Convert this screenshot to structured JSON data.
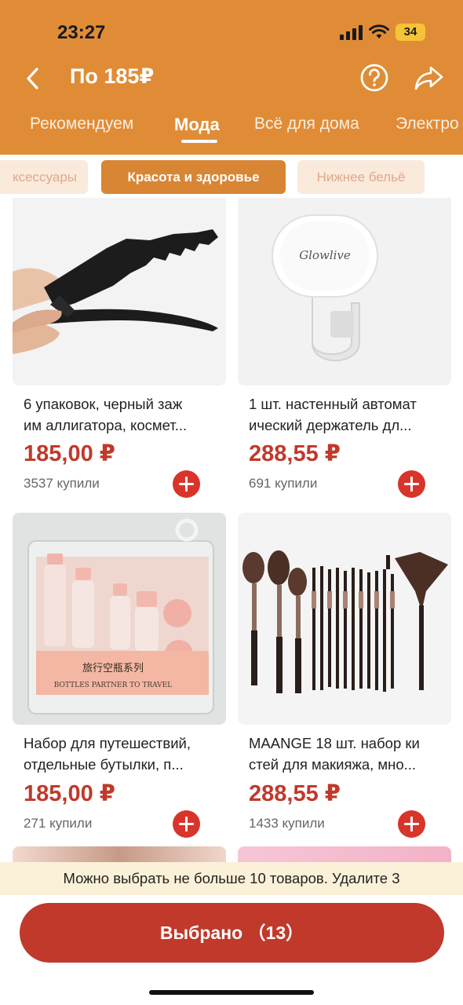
{
  "status_bar": {
    "time": "23:27",
    "battery": "34"
  },
  "topbar": {
    "title": "По 185₽",
    "back_icon": "chevron-left-icon",
    "help_icon": "question-circle-icon",
    "share_icon": "share-arrow-icon"
  },
  "tabs": [
    {
      "label": "Рекомендуем",
      "active": false
    },
    {
      "label": "Мода",
      "active": true
    },
    {
      "label": "Всё для дома",
      "active": false
    },
    {
      "label": "Электро",
      "active": false
    }
  ],
  "chips": [
    {
      "label": "ксессуары",
      "active": false
    },
    {
      "label": "Красота и здоровье",
      "active": true
    },
    {
      "label": "Нижнее бельё",
      "active": false
    }
  ],
  "products": [
    {
      "title_line1": "6 упаковок, черный заж",
      "title_line2": "им аллигатора, космет...",
      "price": "185,00 ₽",
      "sold": "3537 купили"
    },
    {
      "title_line1": "1 шт. настенный автомат",
      "title_line2": "ический держатель дл...",
      "price": "288,55 ₽",
      "sold": "691 купили",
      "brand": "Glowlive"
    },
    {
      "title_line1": "Набор для путешествий,",
      "title_line2": " отдельные бутылки, п...",
      "price": "185,00 ₽",
      "sold": "271 купили",
      "package_line1": "旅行空瓶系列",
      "package_line2": "BOTTLES PARTNER TO TRAVEL"
    },
    {
      "title_line1": "MAANGE 18 шт. набор ки",
      "title_line2": "стей для макияжа, мно...",
      "price": "288,55 ₽",
      "sold": "1433 купили"
    }
  ],
  "notice": "Можно выбрать не больше 10 товаров. Удалите 3",
  "select_button": "Выбрано （13）",
  "colors": {
    "header": "#e08c36",
    "accent": "#c0392b",
    "chip_active": "#d98634",
    "notice_bg": "#fbf1d8"
  }
}
